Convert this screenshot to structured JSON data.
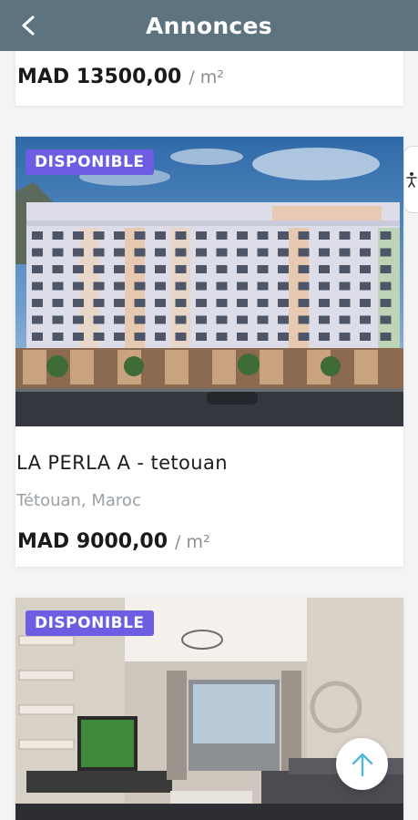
{
  "header": {
    "title": "Annonces",
    "back_icon": "arrow-left-icon"
  },
  "listings": [
    {
      "price": "MAD 13500,00",
      "unit": "/ m²"
    },
    {
      "badge": "DISPONIBLE",
      "title": "LA PERLA A - tetouan",
      "location": "Tétouan, Maroc",
      "price": "MAD 9000,00",
      "unit": "/ m²"
    },
    {
      "badge": "DISPONIBLE"
    }
  ],
  "colors": {
    "header": "#5d7480",
    "badge": "#6c5de3",
    "fab_arrow": "#4db6d9"
  },
  "icons": {
    "accessibility": "accessibility-icon",
    "scroll_top": "arrow-up-icon"
  }
}
